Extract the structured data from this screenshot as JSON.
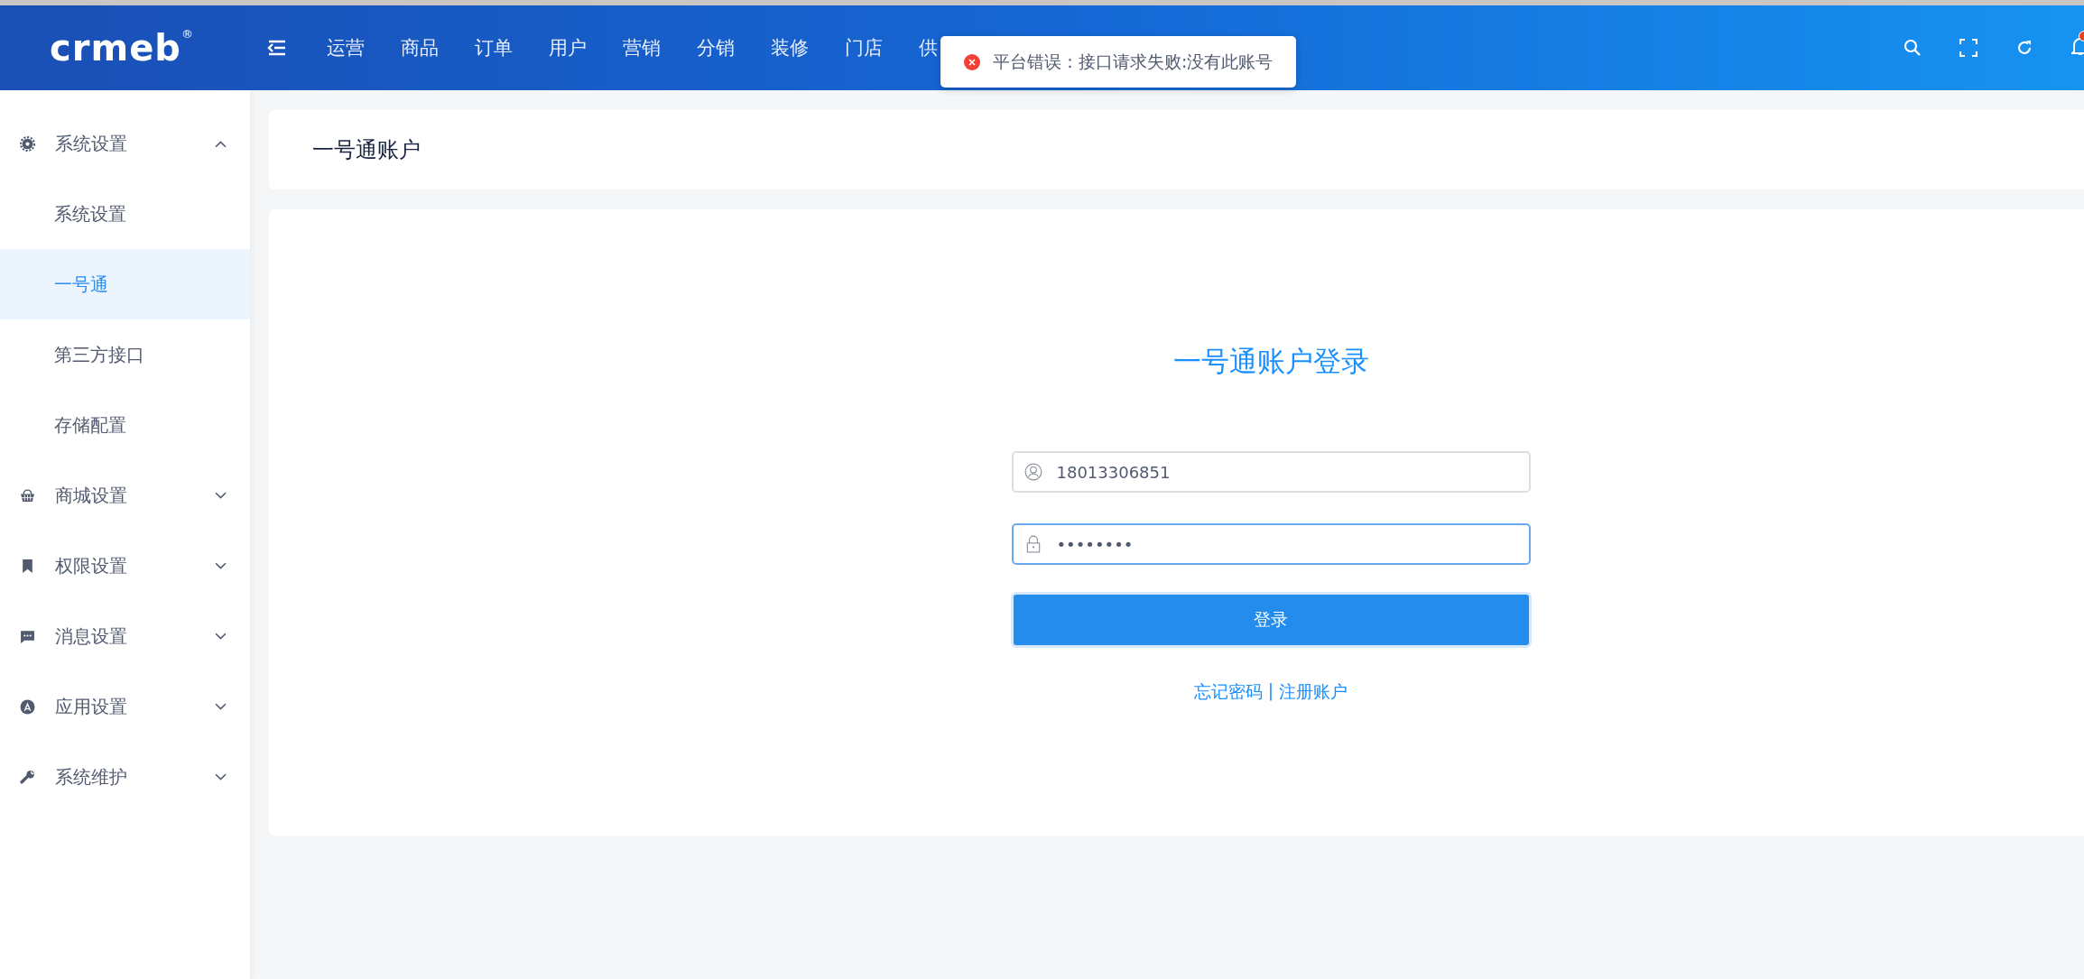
{
  "header": {
    "logo": "crmeb",
    "logo_mark": "®",
    "nav": [
      {
        "label": "运营",
        "selected": false
      },
      {
        "label": "商品",
        "selected": false
      },
      {
        "label": "订单",
        "selected": false
      },
      {
        "label": "用户",
        "selected": false
      },
      {
        "label": "营销",
        "selected": false
      },
      {
        "label": "分销",
        "selected": false
      },
      {
        "label": "装修",
        "selected": false
      },
      {
        "label": "门店",
        "selected": false
      },
      {
        "label": "供",
        "selected": false
      }
    ],
    "notification_badge": true
  },
  "toast": {
    "kind": "error",
    "message": "平台错误：接口请求失败:没有此账号"
  },
  "sidebar": {
    "items": [
      {
        "label": "系统设置",
        "expanded": true,
        "children": [
          {
            "label": "系统设置",
            "selected": false
          },
          {
            "label": "一号通",
            "selected": true
          },
          {
            "label": "第三方接口",
            "selected": false
          },
          {
            "label": "存储配置",
            "selected": false
          }
        ]
      },
      {
        "label": "商城设置",
        "expanded": false
      },
      {
        "label": "权限设置",
        "expanded": false
      },
      {
        "label": "消息设置",
        "expanded": false
      },
      {
        "label": "应用设置",
        "expanded": false
      },
      {
        "label": "系统维护",
        "expanded": false
      }
    ]
  },
  "page_title": "一号通账户",
  "login": {
    "title": "一号通账户登录",
    "account": "18013306851",
    "password": "••••••••",
    "submit": "登录",
    "links": [
      "忘记密码",
      "注册账户"
    ],
    "separator": "|"
  }
}
